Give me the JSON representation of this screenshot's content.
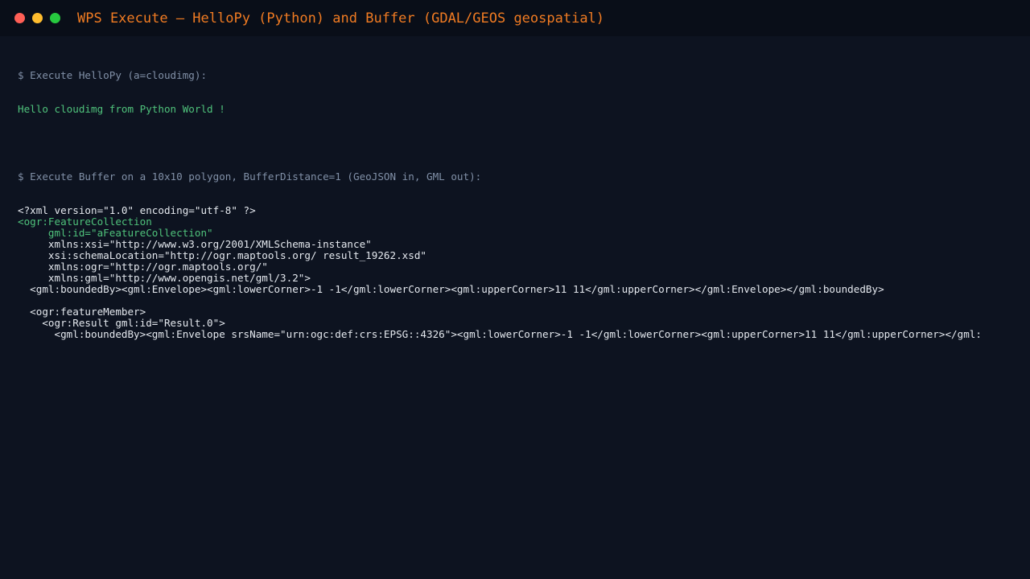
{
  "window": {
    "title": "WPS Execute — HelloPy (Python) and Buffer (GDAL/GEOS geospatial)"
  },
  "colors": {
    "background": "#0d1320",
    "titlebar": "#090e18",
    "title": "#f07b22",
    "comment": "#8190a7",
    "success": "#4fc27b",
    "text": "#e4e8ee"
  },
  "terminal": {
    "hello_command": "$ Execute HelloPy (a=cloudimg):",
    "hello_output": "Hello cloudimg from Python World !",
    "buffer_command": "$ Execute Buffer on a 10x10 polygon, BufferDistance=1 (GeoJSON in, GML out):",
    "xml_lines": [
      {
        "text": "<?xml version=\"1.0\" encoding=\"utf-8\" ?>",
        "style": "white"
      },
      {
        "text": "<ogr:FeatureCollection",
        "style": "green"
      },
      {
        "text": "     gml:id=\"aFeatureCollection\"",
        "style": "green"
      },
      {
        "text": "     xmlns:xsi=\"http://www.w3.org/2001/XMLSchema-instance\"",
        "style": "white"
      },
      {
        "text": "     xsi:schemaLocation=\"http://ogr.maptools.org/ result_19262.xsd\"",
        "style": "white"
      },
      {
        "text": "     xmlns:ogr=\"http://ogr.maptools.org/\"",
        "style": "white"
      },
      {
        "text": "     xmlns:gml=\"http://www.opengis.net/gml/3.2\">",
        "style": "white"
      },
      {
        "text": "  <gml:boundedBy><gml:Envelope><gml:lowerCorner>-1 -1</gml:lowerCorner><gml:upperCorner>11 11</gml:upperCorner></gml:Envelope></gml:boundedBy>",
        "style": "white"
      },
      {
        "text": "",
        "style": "white"
      },
      {
        "text": "  <ogr:featureMember>",
        "style": "white"
      },
      {
        "text": "    <ogr:Result gml:id=\"Result.0\">",
        "style": "white"
      },
      {
        "text": "      <gml:boundedBy><gml:Envelope srsName=\"urn:ogc:def:crs:EPSG::4326\"><gml:lowerCorner>-1 -1</gml:lowerCorner><gml:upperCorner>11 11</gml:upperCorner></gml:",
        "style": "white"
      }
    ]
  }
}
